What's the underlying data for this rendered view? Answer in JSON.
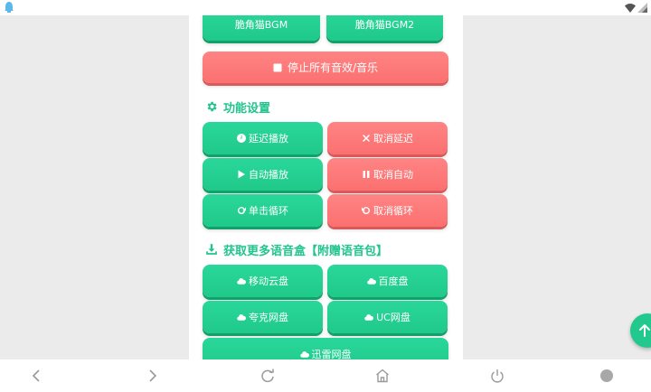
{
  "colors": {
    "green": "#20c98c",
    "red": "#fb7373",
    "section_title": "#21c48d"
  },
  "top_buttons": {
    "bgm1": "脆角猫BGM",
    "bgm2": "脆角猫BGM2"
  },
  "stop_all": {
    "label": "停止所有音效/音乐",
    "icon": "stop-icon"
  },
  "function_settings": {
    "title": "功能设置",
    "icon": "gear-icon",
    "buttons": [
      {
        "label": "延迟播放",
        "icon": "clock-icon"
      },
      {
        "label": "取消延迟",
        "icon": "close-icon"
      },
      {
        "label": "自动播放",
        "icon": "play-icon"
      },
      {
        "label": "取消自动",
        "icon": "pause-icon"
      },
      {
        "label": "单击循环",
        "icon": "redo-icon"
      },
      {
        "label": "取消循环",
        "icon": "undo-icon"
      }
    ]
  },
  "downloads": {
    "title": "获取更多语音盒【附赠语音包】",
    "icon": "download-icon",
    "buttons": [
      {
        "label": "移动云盘",
        "icon": "cloud-icon"
      },
      {
        "label": "百度盘",
        "icon": "cloud-icon"
      },
      {
        "label": "夸克网盘",
        "icon": "cloud-icon"
      },
      {
        "label": "UC网盘",
        "icon": "cloud-icon"
      },
      {
        "label": "迅雷网盘",
        "icon": "cloud-icon"
      }
    ]
  },
  "floating": {
    "icon": "arrow-up-icon"
  },
  "nav_bar": {
    "icons": [
      "back-icon",
      "forward-icon",
      "refresh-icon",
      "home-icon",
      "power-icon",
      "circle-icon"
    ]
  }
}
